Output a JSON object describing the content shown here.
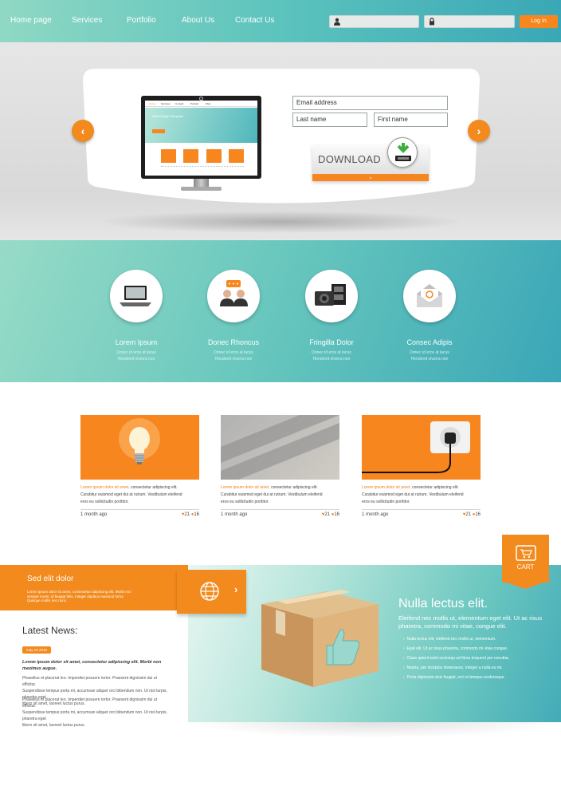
{
  "nav": {
    "items": [
      "Home page",
      "Services",
      "Portfolio",
      "About Us",
      "Contact Us"
    ],
    "login_label": "Log In"
  },
  "hero": {
    "email_placeholder": "Email address",
    "first_name_placeholder": "Last name",
    "last_name_placeholder": "First name",
    "download_label": "DOWNLOAD",
    "screen": {
      "menu": [
        "Home",
        "Services",
        "Contact",
        "Portrait",
        "FAQ"
      ],
      "title": "Web Design Template"
    }
  },
  "features": [
    {
      "title": "Lorem Ipsum",
      "line1": "Donec id eros at lacus",
      "line2": "Hendrerit viverra non",
      "icon": "laptop-icon"
    },
    {
      "title": "Donec Rhoncus",
      "line1": "Donec id eros at lacus",
      "line2": "Hendrerit viverra non",
      "icon": "people-chat-icon"
    },
    {
      "title": "Fringilla Dolor",
      "line1": "Donec id eros at lacus",
      "line2": "Hendrerit viverra non",
      "icon": "camera-film-icon"
    },
    {
      "title": "Consec Adipis",
      "line1": "Donec id eros at lacus",
      "line2": "Hendrerit viverra non",
      "icon": "email-envelope-icon"
    }
  ],
  "cards": [
    {
      "highlight": "Lorem ipsum dolor sit amet,",
      "text1": " consectetur adipiscing elit.",
      "text2": "Curabitur euismod eget dui at rutrum. Vestibulum eleifend",
      "text3": "eros eu sollicitudin porttitor.",
      "time": "1 month ago",
      "likes": "21",
      "comments": "16",
      "image": "light-bulb"
    },
    {
      "highlight": "Lorem ipsum dolor sit amet,",
      "text1": " consectetur adipiscing elit.",
      "text2": "Curabitur euismod eget dui at rutrum. Vestibulum eleifend",
      "text3": "eros eu sollicitudin porttitor.",
      "time": "1 month ago",
      "likes": "21",
      "comments": "16",
      "image": "gray-stripes"
    },
    {
      "highlight": "Lorem ipsum dolor sit amet,",
      "text1": " consectetur adipiscing elit.",
      "text2": "Curabitur euismod eget dui at rutrum. Vestibulum eleifend",
      "text3": "eros eu sollicitudin porttitor.",
      "time": "1 month ago",
      "likes": "21",
      "comments": "16",
      "image": "power-socket"
    }
  ],
  "promo": {
    "title": "Sed elit dolor",
    "line1": "Lorem ipsum dolor sit amet, consectetur adipiscing elit. Morbi non",
    "line2": "semper lorem, id feugiat felis. Integer dapibus euismod tortor.",
    "line3": "Quisque mollis nec nunc."
  },
  "cart_label": "CART",
  "news": {
    "heading": "Latest News:",
    "date": "may 23 2015",
    "lead": "Lorem ipsum dolor sit amet, consectetur adipiscing elit. Morbi non maximus augue.",
    "para1": [
      "Phasellus et placerat leo. Imperdiet posuere tortor. Praesent dignissim dui ut efficitur.",
      "Suspendisse tempus porta mi, accumsan aliquet orci bibendum non. Ut nisl turpis, pharetra eget",
      "libero sit amet, laoreet luctus purus."
    ],
    "para2": [
      "Phasellus et placerat leo. Imperdiet posuere tortor. Praesent dignissim dui ut efficitur.",
      "Suspendisse tempus porta mi, accumsan aliquet orci bibendum non. Ut nisl turpis, pharetra eget",
      "libero sit amet, laoreet luctus purus."
    ]
  },
  "product": {
    "title": "Nulla lectus elit.",
    "subtitle1": "Eleifend nec mollis ut, elementum eget elit. Ut ac risus",
    "subtitle2": "pharetra, commodo mi vitae, congue elit.",
    "bullets": [
      "Nulla lectus elit, eleifend nec mollis ut, elementum.",
      "Eget elit. Ut ac risus pharetra, commodo mi vitae congue.",
      "Class aptent taciti sociosqu ad litora torquent per conubia.",
      "Nostra, per inceptos himenaeos. Integer a nulla eu mi.",
      "Porta dignissim duis feugiat, orci et tempus scelerisque."
    ]
  }
}
